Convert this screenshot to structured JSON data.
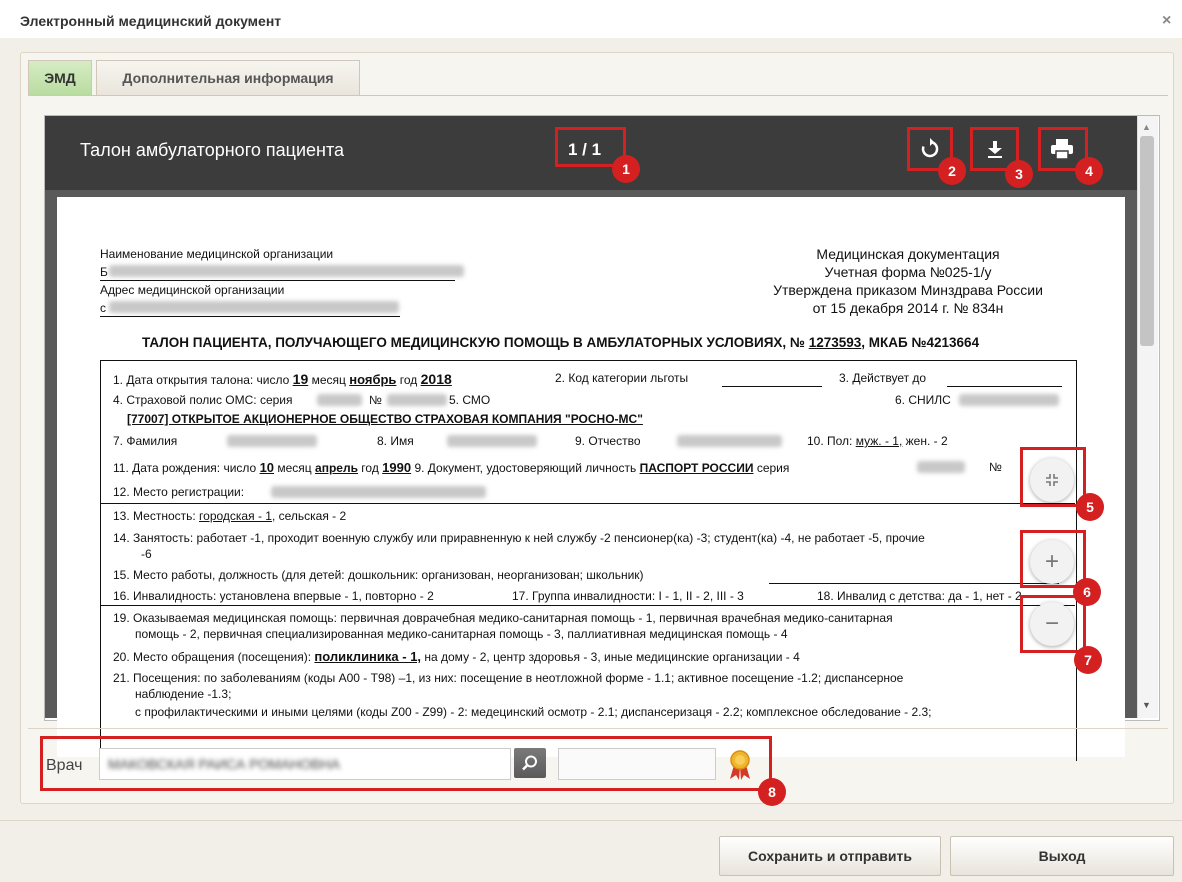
{
  "dialog": {
    "title": "Электронный медицинский документ",
    "close": "×"
  },
  "tabs": [
    {
      "label": "ЭМД"
    },
    {
      "label": "Дополнительная информация"
    }
  ],
  "viewer": {
    "title": "Талон амбулаторного пациента",
    "page_count": "1 / 1",
    "badges": [
      "1",
      "2",
      "3",
      "4",
      "5",
      "6",
      "7",
      "8"
    ]
  },
  "document": {
    "org_name_label": "Наименование медицинской организации",
    "org_name_prefix": "Б",
    "org_address_label": "Адрес медицинской организации",
    "org_address_prefix": "с",
    "header_right": [
      "Медицинская документация",
      "Учетная форма №025-1/у",
      "Утверждена приказом Минздрава России",
      "от 15 декабря 2014 г. № 834н"
    ],
    "heading": "ТАЛОН ПАЦИЕНТА, ПОЛУЧАЮЩЕГО МЕДИЦИНСКУЮ ПОМОЩЬ В АМБУЛАТОРНЫХ УСЛОВИЯХ, №",
    "heading_num": "1273593",
    "heading_tail": ", МКАБ №4213664",
    "r1_label": "1. Дата открытия талона: число",
    "r1_day": "19",
    "r1_month_label": "месяц",
    "r1_month": "ноябрь",
    "r1_year_label": "год",
    "r1_year": "2018",
    "r1_code": "2. Код категории льготы",
    "r1_valid": "3. Действует до",
    "r2_policy": "4. Страховой полис ОМС: серия",
    "r2_no": "№",
    "r2_smo": "5. СМО",
    "r2_snils": "6. СНИЛС",
    "r3_company": "[77007] ОТКРЫТОЕ АКЦИОНЕРНОЕ ОБЩЕСТВО СТРАХОВАЯ КОМПАНИЯ \"РОСНО-МС\"",
    "r4_surname": "7. Фамилия",
    "r4_name": "8. Имя",
    "r4_patr": "9. Отчество",
    "r4_sex": "10. Пол:",
    "r4_sex_m": "муж. - 1,",
    "r4_sex_f": "жен. - 2",
    "r5_birth": "11. Дата рождения: число",
    "r5_day": "10",
    "r5_month_label": "месяц",
    "r5_month": "апрель",
    "r5_year_label": "год",
    "r5_year": "1990",
    "r5_doc": "9. Документ, удостоверяющий личность",
    "r5_doc_val": "ПАСПОРТ РОССИИ",
    "r5_series": "серия",
    "r5_no": "№",
    "r6": "12. Место регистрации:",
    "r7_label": "13. Местность:",
    "r7_city": "городская - 1",
    "r7_rural": ", сельская - 2",
    "r8a": "14. Занятость: работает -1, проходит военную службу или приравненную к ней службу -2 пенсионер(ка) -3; студент(ка) -4, не работает -5, прочие",
    "r8b": "-6",
    "r9": "15. Место работы, должность (для детей: дошкольник: организован, неорганизован; школьник)",
    "r10a": "16. Инвалидность: установлена впервые - 1, повторно - 2",
    "r10b": "17. Группа инвалидности: I - 1, II - 2, III - 3",
    "r10c": "18. Инвалид с детства: да - 1, нет - 2",
    "r11a": "19. Оказываемая медицинская помощь: первичная доврачебная медико-санитарная помощь - 1, первичная врачебная медико-санитарная",
    "r11b": "помощь - 2, первичная специализированная медико-санитарная помощь - 3, паллиативная медицинская помощь - 4",
    "r12_label": "20. Место обращения (посещения):",
    "r12_val": "поликлиника - 1,",
    "r12_rest": "на дому - 2,  центр здоровья - 3, иные медицинские организации - 4",
    "r13a": "21. Посещения: по заболеваниям (коды А00 - Т98) –1,  из них: посещение в неотложной форме - 1.1; активное посещение -1.2;  диспансерное",
    "r13b": "наблюдение -1.3;",
    "r13c": "с профилактическими и иными целями (коды Z00 - Z99) - 2: медецинский осмотр - 2.1;  диспансеризаця - 2.2;  комплексное обследование - 2.3;"
  },
  "footer_field": {
    "label": "Врач",
    "value": "МАКОВСКАЯ РАИСА РОМАНОВНА"
  },
  "buttons": {
    "save": "Сохранить и отправить",
    "exit": "Выход"
  },
  "colors": {
    "accent_red": "#d42020",
    "viewer_header": "#3c3c3c",
    "active_tab": "#c7e3b0"
  }
}
